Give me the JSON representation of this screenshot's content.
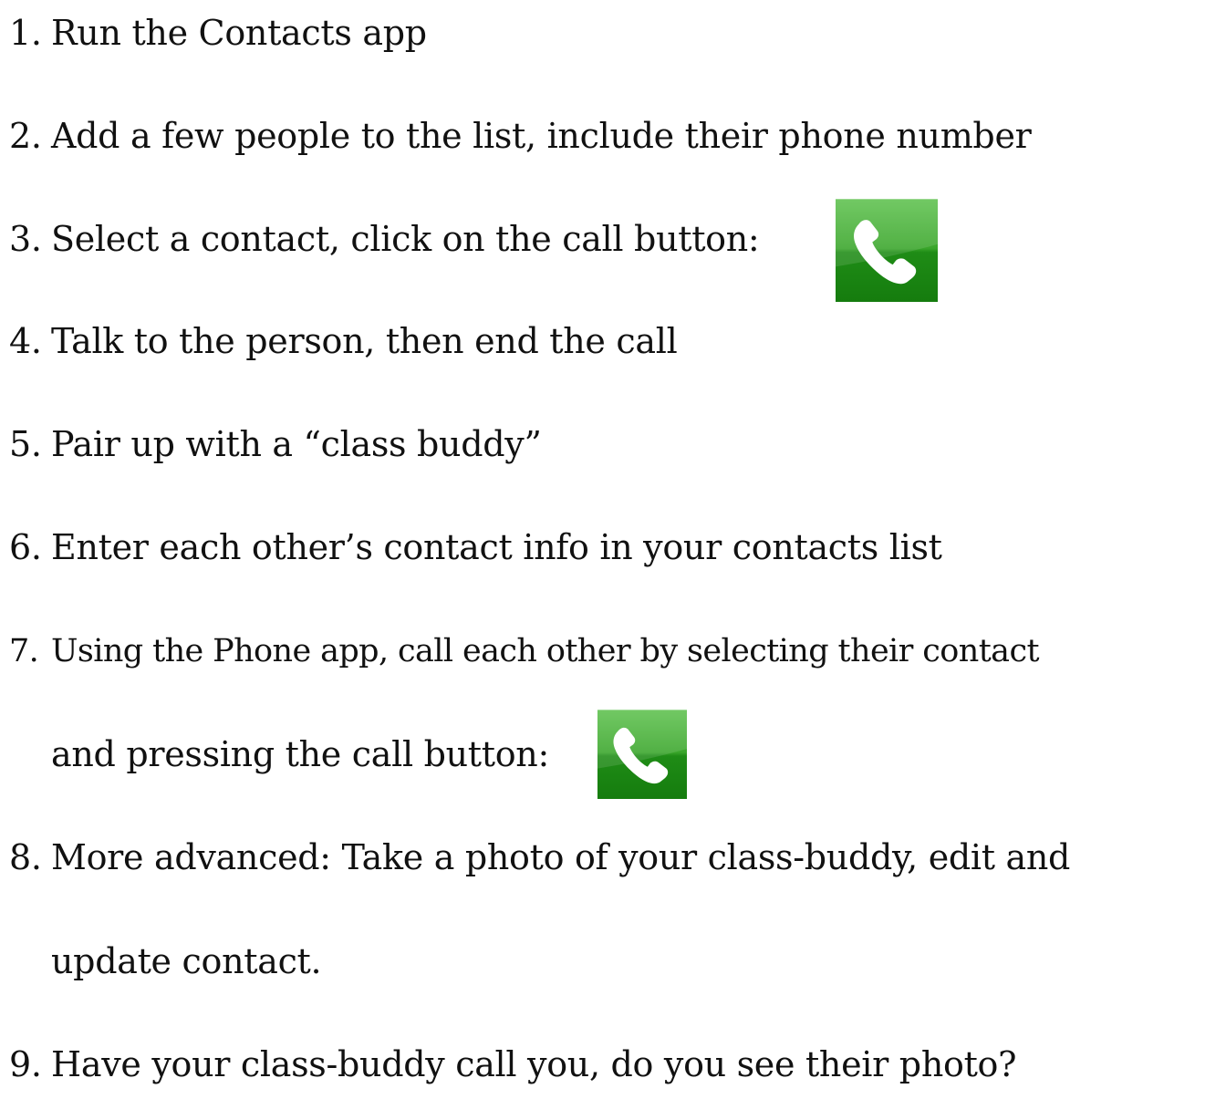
{
  "steps": [
    {
      "num": "1.",
      "text": "Run the Contacts app"
    },
    {
      "num": "2.",
      "text": "Add a few people to the list, include their phone number"
    },
    {
      "num": "3.",
      "text": "Select a contact, click on the call button:"
    },
    {
      "num": "4.",
      "text": "Talk to the person, then end the call"
    },
    {
      "num": "5.",
      "text": "Pair up with a “class buddy”"
    },
    {
      "num": "6.",
      "text": "Enter each other’s contact info in your contacts list"
    },
    {
      "num": "7.",
      "text": "Using the Phone app, call each other by selecting their contact",
      "cont": "and pressing the call button:"
    },
    {
      "num": "8.",
      "text": "More advanced: Take a photo of your class-buddy, edit and",
      "cont": "update contact."
    },
    {
      "num": "9.",
      "text": "Have your class-buddy call you, do you see their photo?"
    }
  ],
  "icons": {
    "call_button": "phone-call-icon",
    "call_button_color": "#2fa025"
  }
}
